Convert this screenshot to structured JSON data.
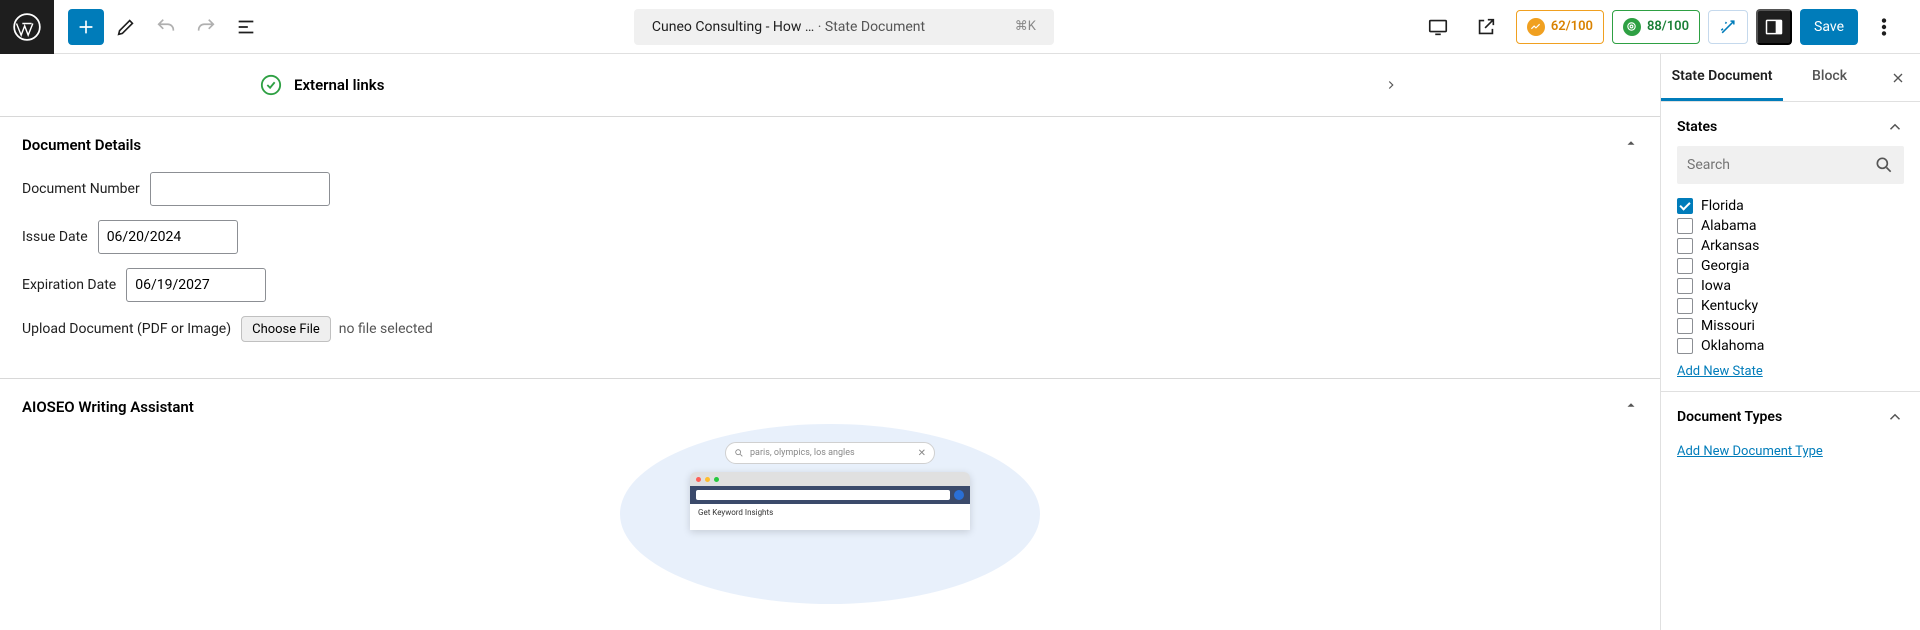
{
  "topbar": {
    "doc_title": "Cuneo Consulting - How …",
    "doc_type_prefix": "· ",
    "doc_type": "State Document",
    "shortcut": "⌘K",
    "score_left": "62/100",
    "score_right": "88/100",
    "save_label": "Save"
  },
  "ext_links": {
    "label": "External links"
  },
  "doc_details": {
    "title": "Document Details",
    "doc_number_label": "Document Number",
    "doc_number_value": "",
    "issue_date_label": "Issue Date",
    "issue_date_value": "06/20/2024",
    "exp_date_label": "Expiration Date",
    "exp_date_value": "06/19/2027",
    "upload_label": "Upload Document (PDF or Image)",
    "choose_file_label": "Choose File",
    "no_file_label": "no file selected"
  },
  "assistant": {
    "title": "AIOSEO Writing Assistant",
    "search_placeholder": "paris, olympics, los angles",
    "body_line": "Get Keyword Insights"
  },
  "sidebar": {
    "tabs": {
      "doc": "State Document",
      "block": "Block"
    },
    "states_title": "States",
    "search_placeholder": "Search",
    "states": [
      {
        "name": "Florida",
        "checked": true
      },
      {
        "name": "Alabama",
        "checked": false
      },
      {
        "name": "Arkansas",
        "checked": false
      },
      {
        "name": "Georgia",
        "checked": false
      },
      {
        "name": "Iowa",
        "checked": false
      },
      {
        "name": "Kentucky",
        "checked": false
      },
      {
        "name": "Missouri",
        "checked": false
      },
      {
        "name": "Oklahoma",
        "checked": false
      }
    ],
    "add_state": "Add New State",
    "doc_types_title": "Document Types",
    "add_doc_type": "Add New Document Type"
  }
}
